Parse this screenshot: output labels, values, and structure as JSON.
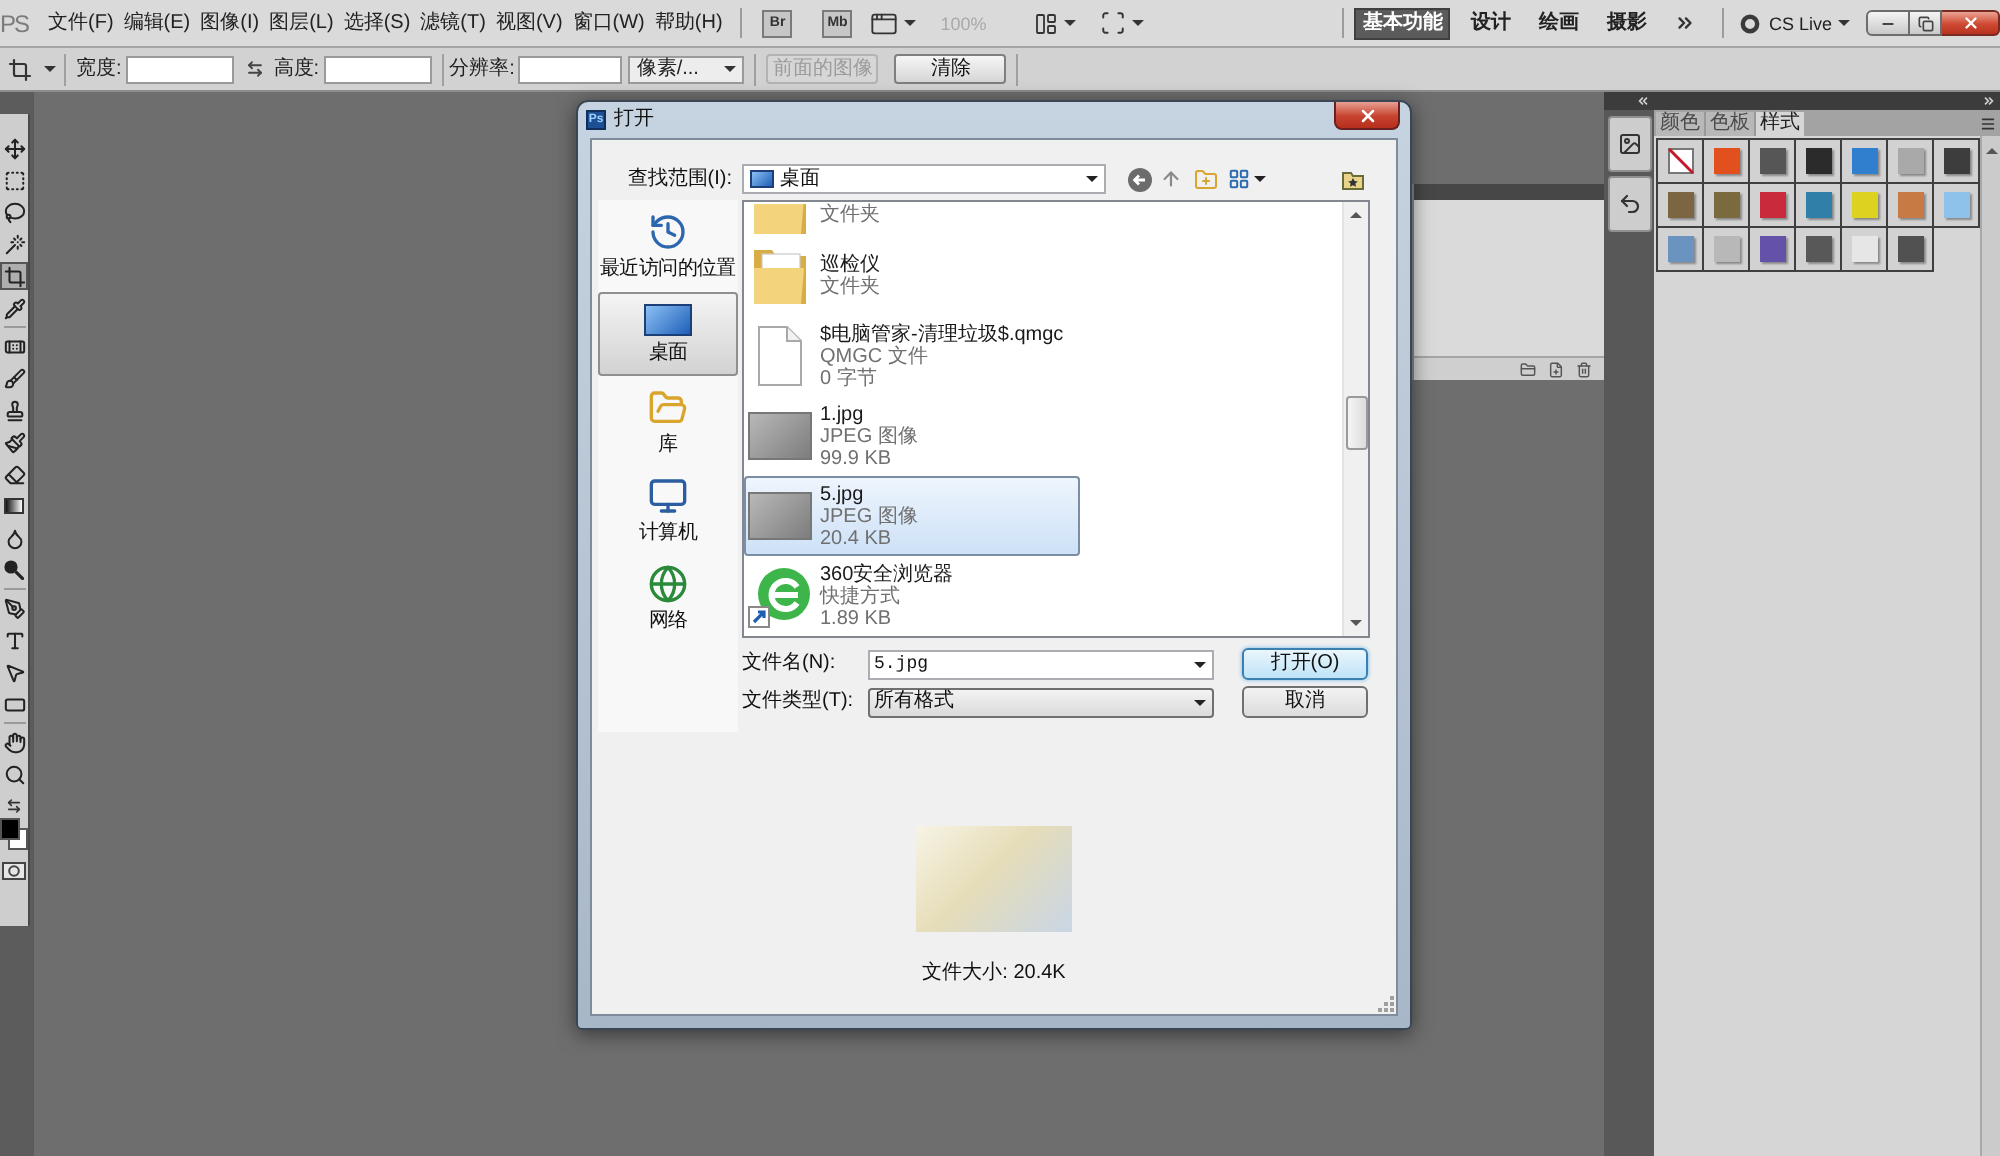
{
  "menubar": {
    "logo": "PS",
    "menus": [
      "文件(F)",
      "编辑(E)",
      "图像(I)",
      "图层(L)",
      "选择(S)",
      "滤镜(T)",
      "视图(V)",
      "窗口(W)",
      "帮助(H)"
    ],
    "app_buttons": [
      "Br",
      "Mb"
    ],
    "zoom": {
      "value": "100%",
      "disabled": true
    },
    "workspaces": [
      {
        "label": "基本功能",
        "selected": true
      },
      {
        "label": "设计",
        "selected": false
      },
      {
        "label": "绘画",
        "selected": false
      },
      {
        "label": "摄影",
        "selected": false
      }
    ],
    "cs_live": "CS Live"
  },
  "options_bar": {
    "width_label": "宽度:",
    "height_label": "高度:",
    "resolution_label": "分辨率:",
    "unit": "像素/...",
    "buttons": [
      {
        "label": "前面的图像",
        "disabled": true
      },
      {
        "label": "清除",
        "disabled": false
      }
    ]
  },
  "tools": [
    {
      "kind": "move",
      "selected": false
    },
    {
      "kind": "marquee",
      "selected": false
    },
    {
      "kind": "lasso",
      "selected": false
    },
    {
      "kind": "wand",
      "selected": false
    },
    {
      "kind": "crop",
      "selected": true
    },
    {
      "kind": "eyedropper",
      "selected": false
    },
    {
      "kind": "healing",
      "selected": false
    },
    {
      "kind": "brush",
      "selected": false
    },
    {
      "kind": "stamp",
      "selected": false
    },
    {
      "kind": "history-brush",
      "selected": false
    },
    {
      "kind": "eraser",
      "selected": false
    },
    {
      "kind": "gradient",
      "selected": false
    },
    {
      "kind": "blur",
      "selected": false
    },
    {
      "kind": "dodge",
      "selected": false
    },
    {
      "kind": "pen",
      "selected": false
    },
    {
      "kind": "type",
      "selected": false
    },
    {
      "kind": "path-select",
      "selected": false
    },
    {
      "kind": "shape",
      "selected": false
    },
    {
      "kind": "hand",
      "selected": false
    },
    {
      "kind": "zoom",
      "selected": false
    }
  ],
  "styles_panel": {
    "tabs": [
      {
        "label": "颜色",
        "selected": false
      },
      {
        "label": "色板",
        "selected": false
      },
      {
        "label": "样式",
        "selected": true
      }
    ],
    "swatches": [
      {
        "kind": "none"
      },
      {
        "kind": "style",
        "color": "#e2511d"
      },
      {
        "kind": "style",
        "color": "#565656"
      },
      {
        "kind": "style",
        "color": "#2b2b2b"
      },
      {
        "kind": "style",
        "color": "#2f7fce"
      },
      {
        "kind": "style",
        "color": "#a9a9a9"
      },
      {
        "kind": "style",
        "color": "#3d3d3d"
      },
      {
        "kind": "style",
        "color": "#7c6642"
      },
      {
        "kind": "style",
        "color": "#7b6a3e"
      },
      {
        "kind": "style",
        "color": "#c92b3d"
      },
      {
        "kind": "style",
        "color": "#2f7fa8"
      },
      {
        "kind": "style",
        "color": "#ddd21f"
      },
      {
        "kind": "style",
        "color": "#c77a44"
      },
      {
        "kind": "style",
        "color": "#8fc2ea"
      },
      {
        "kind": "style",
        "color": "#6b93bf"
      },
      {
        "kind": "style",
        "color": "#b8b8b8"
      },
      {
        "kind": "style",
        "color": "#6352a8"
      },
      {
        "kind": "style",
        "color": "#585858"
      },
      {
        "kind": "style",
        "color": "#e6e6e6"
      },
      {
        "kind": "style",
        "color": "#515151"
      }
    ]
  },
  "dialog": {
    "app_icon": "Ps",
    "title": "打开",
    "look_in": {
      "label": "查找范围(I):",
      "value": "桌面"
    },
    "places": [
      {
        "kind": "recent",
        "label": "最近访问的位置",
        "selected": false
      },
      {
        "kind": "desktop",
        "label": "桌面",
        "selected": true
      },
      {
        "kind": "library",
        "label": "库",
        "selected": false
      },
      {
        "kind": "computer",
        "label": "计算机",
        "selected": false
      },
      {
        "kind": "network",
        "label": "网络",
        "selected": false
      }
    ],
    "files": [
      {
        "kind": "folder",
        "type": "文件夹",
        "selected": false
      },
      {
        "kind": "folder",
        "name": "巡检仪",
        "type": "文件夹",
        "selected": false
      },
      {
        "kind": "file",
        "name": "$电脑管家-清理垃圾$.qmgc",
        "type": "QMGC 文件",
        "size": "0 字节",
        "selected": false
      },
      {
        "kind": "image",
        "name": "1.jpg",
        "type": "JPEG 图像",
        "size": "99.9 KB",
        "selected": false
      },
      {
        "kind": "image",
        "name": "5.jpg",
        "type": "JPEG 图像",
        "size": "20.4 KB",
        "selected": true
      },
      {
        "kind": "shortcut",
        "name": "360安全浏览器",
        "type": "快捷方式",
        "size": "1.89 KB",
        "selected": false
      }
    ],
    "file_name": {
      "label": "文件名(N):",
      "value": "5.jpg"
    },
    "file_type": {
      "label": "文件类型(T):",
      "value": "所有格式"
    },
    "buttons": [
      {
        "label": "打开(O)",
        "default": true
      },
      {
        "label": "取消",
        "default": false
      }
    ],
    "file_size": "文件大小: 20.4K"
  }
}
